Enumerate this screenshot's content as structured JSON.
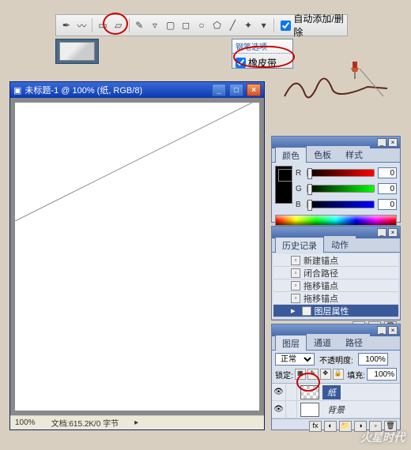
{
  "options_bar": {
    "auto_add_remove": "自动添加/删除"
  },
  "flyout": {
    "title": "钢笔选项",
    "rubber_band": "橡皮带"
  },
  "doc_window": {
    "title": "未标题-1 @ 100% (纸, RGB/8)"
  },
  "status_bar": {
    "zoom": "100%",
    "doc_info": "文档:615.2K/0 字节"
  },
  "color_panel": {
    "tabs": [
      "颜色",
      "色板",
      "样式"
    ],
    "channels": {
      "r": {
        "label": "R",
        "value": "0"
      },
      "g": {
        "label": "G",
        "value": "0"
      },
      "b": {
        "label": "B",
        "value": "0"
      }
    }
  },
  "history_panel": {
    "tabs": [
      "历史记录",
      "动作"
    ],
    "items": [
      {
        "label": "新建锚点"
      },
      {
        "label": "闭合路径"
      },
      {
        "label": "拖移锚点"
      },
      {
        "label": "拖移锚点"
      },
      {
        "label": "图层属性",
        "active": true
      }
    ]
  },
  "layers_panel": {
    "tabs": [
      "图层",
      "通道",
      "路径"
    ],
    "blend_label": "正常",
    "opacity_label": "不透明度:",
    "opacity": "100%",
    "lock_label": "锁定:",
    "fill_label": "填充:",
    "fill": "100%",
    "layers": [
      {
        "name": "纸",
        "active": true,
        "checker": true
      },
      {
        "name": "背景",
        "active": false,
        "checker": false
      }
    ]
  },
  "watermark": "火星时代"
}
